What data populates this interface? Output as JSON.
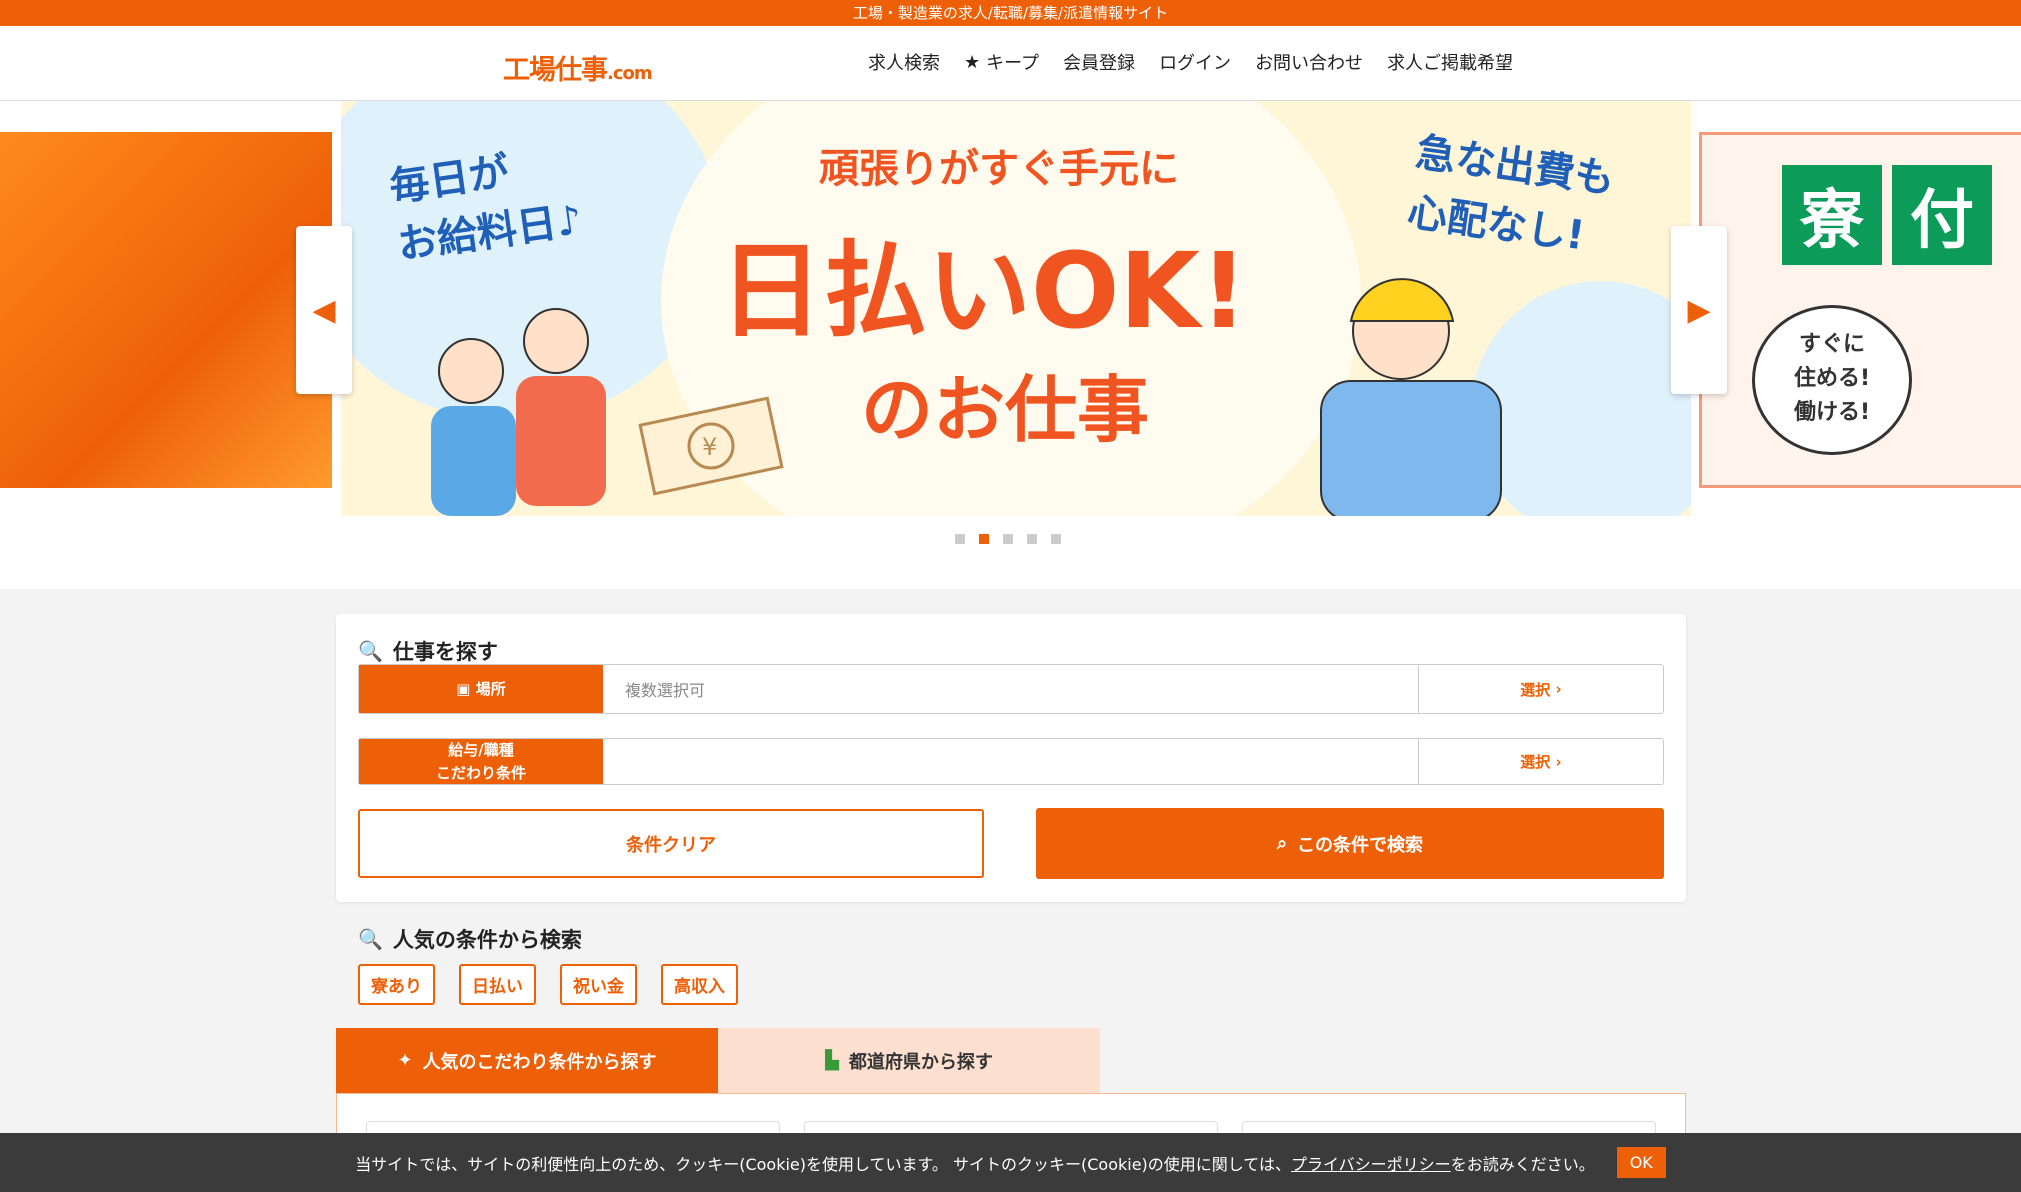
{
  "topbar": {
    "text": "工場・製造業の求人/転職/募集/派遣情報サイト"
  },
  "header": {
    "logo": "工場仕事",
    "logo_suffix": ".com",
    "nav": [
      {
        "label": "求人検索",
        "icon": ""
      },
      {
        "label": "キープ",
        "icon": "star-icon"
      },
      {
        "label": "会員登録",
        "icon": ""
      },
      {
        "label": "ログイン",
        "icon": ""
      },
      {
        "label": "お問い合わせ",
        "icon": ""
      },
      {
        "label": "求人ご掲載希望",
        "icon": ""
      }
    ]
  },
  "hero": {
    "left_text": "毎日が\nお給料日♪",
    "sub": "頑張りがすぐ手元に",
    "main": "日払いOK!",
    "main2": "のお仕事",
    "right_text": "急な出費も\n心配なし!",
    "right_slide_badge1": "寮",
    "right_slide_badge2": "付",
    "right_slide_bubble": "すぐに\n住める!\n働ける!",
    "dots": 5,
    "active_dot": 1
  },
  "search": {
    "title": "仕事を探す",
    "place_label": "場所",
    "place_placeholder": "複数選択可",
    "select_label": "選択",
    "cond_label_line1": "給与/職種",
    "cond_label_line2": "こだわり条件",
    "cond_value": "",
    "clear_label": "条件クリア",
    "search_label": "この条件で検索"
  },
  "popular": {
    "title": "人気の条件から検索",
    "tags": [
      "寮あり",
      "日払い",
      "祝い金",
      "高収入"
    ]
  },
  "tabs": {
    "active": "人気のこだわり条件から探す",
    "inactive": "都道府県から探す"
  },
  "cookie": {
    "text_before": "当サイトでは、サイトの利便性向上のため、クッキー(Cookie)を使用しています。 サイトのクッキー(Cookie)の使用に関しては、",
    "link": "プライバシーポリシー",
    "text_after": "をお読みください。",
    "ok": "OK"
  },
  "colors": {
    "accent": "#ee6008",
    "tab_inactive": "#fde0d0",
    "cookie_bg": "#3b3b3b"
  }
}
